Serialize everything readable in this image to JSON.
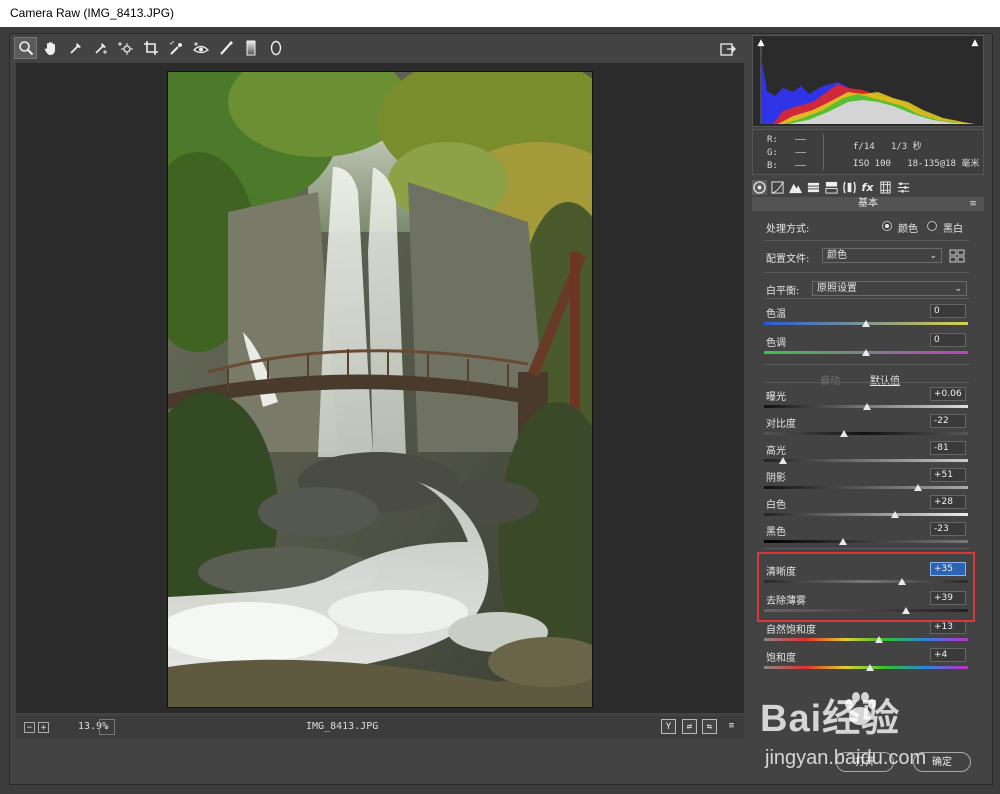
{
  "window": {
    "title": "Camera Raw (IMG_8413.JPG)"
  },
  "toolbar": {
    "tools": [
      "zoom-tool",
      "hand-tool",
      "white-balance-tool",
      "color-sampler-tool",
      "targeted-adjustment-tool",
      "crop-tool",
      "spot-removal-tool",
      "red-eye-tool",
      "adjustment-brush-tool",
      "graduated-filter-tool",
      "radial-filter-tool"
    ],
    "export_icon": "export-icon"
  },
  "statusbar": {
    "zoom": "13.9%",
    "filename": "IMG_8413.JPG",
    "view_buttons": [
      "Y",
      "⇄",
      "⇆",
      "≡"
    ]
  },
  "metadata": {
    "r_label": "R:",
    "g_label": "G:",
    "b_label": "B:",
    "r_value": "——",
    "g_value": "——",
    "b_value": "——",
    "aperture": "f/14",
    "shutter": "1/3 秒",
    "iso": "ISO 100",
    "lens": "18-135@18 毫米"
  },
  "panel": {
    "title": "基本",
    "treatment_label": "处理方式:",
    "treatment_color": "颜色",
    "treatment_bw": "黑白",
    "profile_label": "配置文件:",
    "profile_value": "颜色",
    "wb_label": "白平衡:",
    "wb_value": "原照设置",
    "auto_label": "自动",
    "default_label": "默认值"
  },
  "sliders": [
    {
      "label": "色温",
      "value": "0",
      "pos": 0.5,
      "gradient": "linear-gradient(90deg,#2a5bd6,#d8d24a)"
    },
    {
      "label": "色调",
      "value": "0",
      "pos": 0.5,
      "gradient": "linear-gradient(90deg,#3cc24a,#c23cc2)"
    },
    {
      "label": "曝光",
      "value": "+0.06",
      "pos": 0.503,
      "gradient": "linear-gradient(90deg,#111,#ddd)"
    },
    {
      "label": "对比度",
      "value": "-22",
      "pos": 0.39,
      "gradient": "linear-gradient(90deg,#555,#111 50%,#555)"
    },
    {
      "label": "高光",
      "value": "-81",
      "pos": 0.095,
      "gradient": "linear-gradient(90deg,#222,#ccc)"
    },
    {
      "label": "阴影",
      "value": "+51",
      "pos": 0.755,
      "gradient": "linear-gradient(90deg,#111,#aaa)"
    },
    {
      "label": "白色",
      "value": "+28",
      "pos": 0.64,
      "gradient": "linear-gradient(90deg,#222,#eee)"
    },
    {
      "label": "黑色",
      "value": "-23",
      "pos": 0.385,
      "gradient": "linear-gradient(90deg,#000,#777)"
    },
    {
      "label": "清晰度",
      "value": "+35",
      "pos": 0.675,
      "gradient": "linear-gradient(90deg,#2a2a2a,#777 50%,#2a2a2a)",
      "focused": true
    },
    {
      "label": "去除薄雾",
      "value": "+39",
      "pos": 0.695,
      "gradient": "linear-gradient(90deg,#666,#222)"
    },
    {
      "label": "自然饱和度",
      "value": "+13",
      "pos": 0.565,
      "gradient": "linear-gradient(90deg,#888,#e03030,#e0d030,#30c030,#3080e0,#c030c0)"
    },
    {
      "label": "饱和度",
      "value": "+4",
      "pos": 0.52,
      "gradient": "linear-gradient(90deg,#888,#e03030,#e0d030,#30c030,#3080e0,#c030c0)"
    }
  ],
  "buttons": {
    "open": "打开",
    "done": "确定"
  },
  "watermark": {
    "brand": "Bai经验",
    "url": "jingyan.baidu.com"
  },
  "colors": {
    "accent_red": "#d83a3a",
    "focus_blue": "#2c64b5"
  }
}
